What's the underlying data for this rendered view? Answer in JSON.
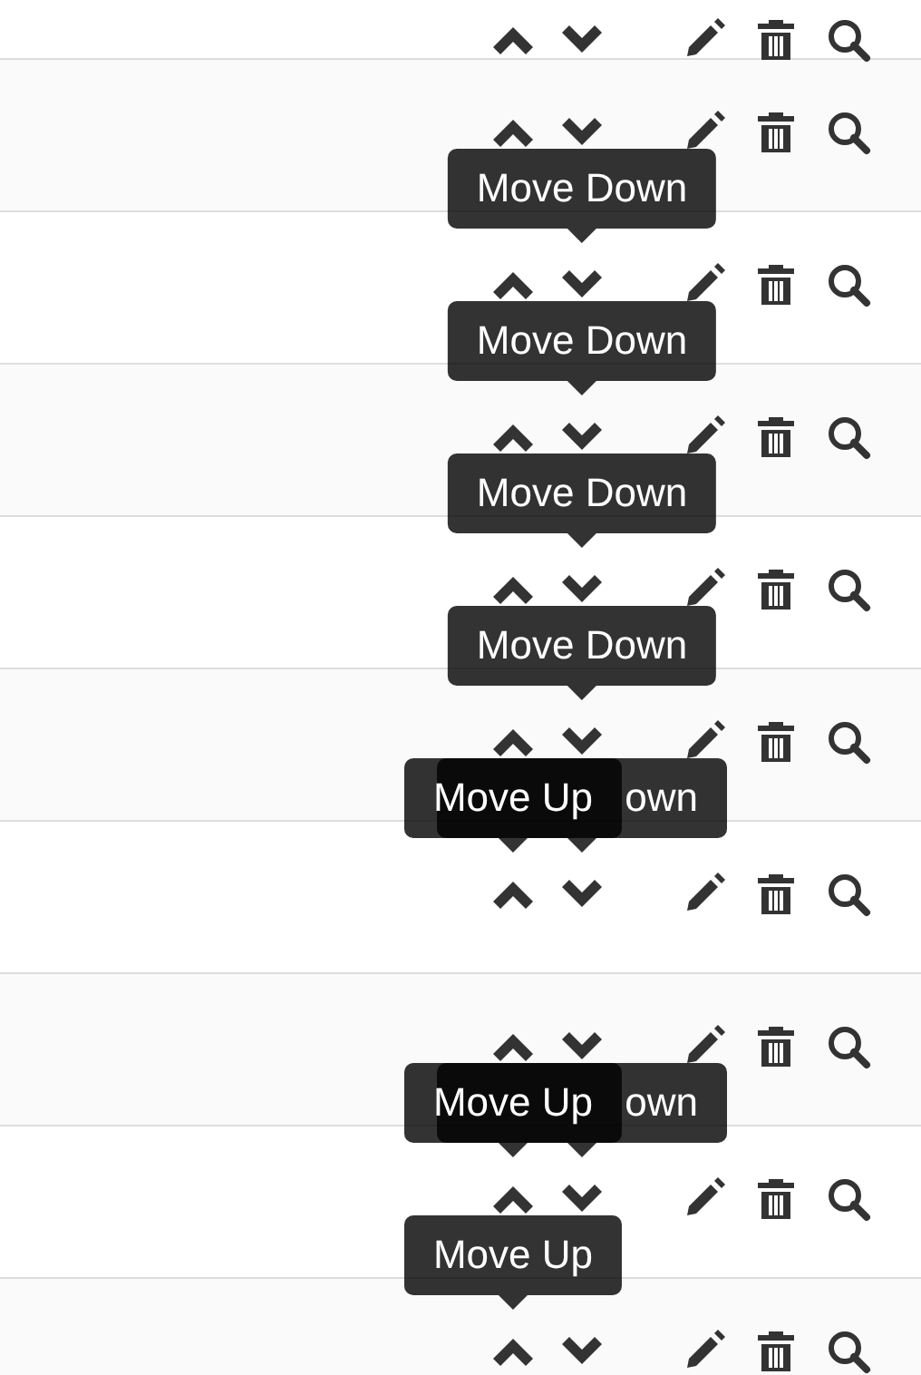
{
  "rows": [
    {
      "tooltips": []
    },
    {
      "tooltips": []
    },
    {
      "tooltips": [
        {
          "kind": "down",
          "text": "Move Down",
          "covered": false
        }
      ]
    },
    {
      "tooltips": [
        {
          "kind": "down",
          "text": "Move Down",
          "covered": false
        }
      ]
    },
    {
      "tooltips": [
        {
          "kind": "down",
          "text": "Move Down",
          "covered": false
        }
      ]
    },
    {
      "tooltips": [
        {
          "kind": "down",
          "text": "Move Down",
          "covered": false
        }
      ]
    },
    {
      "tooltips": [
        {
          "kind": "up",
          "text": "Move Up",
          "covered": false
        },
        {
          "kind": "down",
          "text": "own",
          "covered": true
        }
      ]
    },
    {
      "tooltips": []
    },
    {
      "tooltips": [
        {
          "kind": "up",
          "text": "Move Up",
          "covered": false
        },
        {
          "kind": "down",
          "text": "own",
          "covered": true
        }
      ]
    },
    {
      "tooltips": [
        {
          "kind": "up",
          "text": "Move Up",
          "covered": false
        }
      ]
    }
  ]
}
